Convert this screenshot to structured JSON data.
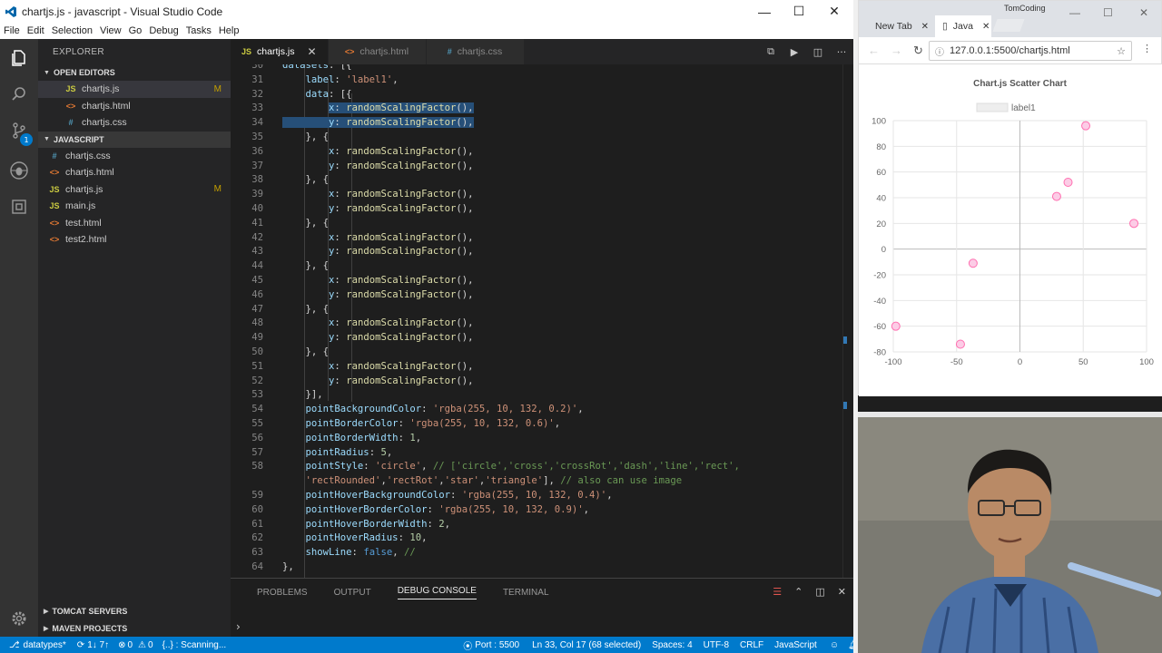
{
  "window": {
    "title": "chartjs.js - javascript - Visual Studio Code"
  },
  "menu": [
    "File",
    "Edit",
    "Selection",
    "View",
    "Go",
    "Debug",
    "Tasks",
    "Help"
  ],
  "activity": {
    "badge": "1"
  },
  "sidebar": {
    "header": "EXPLORER",
    "open_editors_title": "OPEN EDITORS",
    "open_editors": [
      {
        "icon": "JS",
        "name": "chartjs.js",
        "mod": "M"
      },
      {
        "icon": "<>",
        "name": "chartjs.html",
        "mod": ""
      },
      {
        "icon": "#",
        "name": "chartjs.css",
        "mod": ""
      }
    ],
    "folder_title": "JAVASCRIPT",
    "files": [
      {
        "icon": "#",
        "name": "chartjs.css",
        "mod": ""
      },
      {
        "icon": "<>",
        "name": "chartjs.html",
        "mod": ""
      },
      {
        "icon": "JS",
        "name": "chartjs.js",
        "mod": "M"
      },
      {
        "icon": "JS",
        "name": "main.js",
        "mod": ""
      },
      {
        "icon": "<>",
        "name": "test.html",
        "mod": ""
      },
      {
        "icon": "<>",
        "name": "test2.html",
        "mod": ""
      }
    ],
    "tomcat": "TOMCAT SERVERS",
    "maven": "MAVEN PROJECTS"
  },
  "tabs": [
    {
      "icon": "JS",
      "name": "chartjs.js",
      "active": true
    },
    {
      "icon": "<>",
      "name": "chartjs.html",
      "active": false
    },
    {
      "icon": "#",
      "name": "chartjs.css",
      "active": false
    }
  ],
  "code": [
    {
      "n": "30",
      "t": "datasets: [{"
    },
    {
      "n": "31",
      "t": "label: 'label1',"
    },
    {
      "n": "32",
      "t": "data: [{"
    },
    {
      "n": "33",
      "t": "x: randomScalingFactor(),"
    },
    {
      "n": "34",
      "t": "y: randomScalingFactor(),"
    },
    {
      "n": "35",
      "t": "}, {"
    },
    {
      "n": "36",
      "t": "x: randomScalingFactor(),"
    },
    {
      "n": "37",
      "t": "y: randomScalingFactor(),"
    },
    {
      "n": "38",
      "t": "}, {"
    },
    {
      "n": "39",
      "t": "x: randomScalingFactor(),"
    },
    {
      "n": "40",
      "t": "y: randomScalingFactor(),"
    },
    {
      "n": "41",
      "t": "}, {"
    },
    {
      "n": "42",
      "t": "x: randomScalingFactor(),"
    },
    {
      "n": "43",
      "t": "y: randomScalingFactor(),"
    },
    {
      "n": "44",
      "t": "}, {"
    },
    {
      "n": "45",
      "t": "x: randomScalingFactor(),"
    },
    {
      "n": "46",
      "t": "y: randomScalingFactor(),"
    },
    {
      "n": "47",
      "t": "}, {"
    },
    {
      "n": "48",
      "t": "x: randomScalingFactor(),"
    },
    {
      "n": "49",
      "t": "y: randomScalingFactor(),"
    },
    {
      "n": "50",
      "t": "}, {"
    },
    {
      "n": "51",
      "t": "x: randomScalingFactor(),"
    },
    {
      "n": "52",
      "t": "y: randomScalingFactor(),"
    },
    {
      "n": "53",
      "t": "}],"
    },
    {
      "n": "54",
      "t": "pointBackgroundColor: 'rgba(255, 10, 132, 0.2)',"
    },
    {
      "n": "55",
      "t": "pointBorderColor: 'rgba(255, 10, 132, 0.6)',"
    },
    {
      "n": "56",
      "t": "pointBorderWidth: 1,"
    },
    {
      "n": "57",
      "t": "pointRadius: 5,"
    },
    {
      "n": "58",
      "t": "pointStyle: 'circle', // ['circle','cross','crossRot','dash','line','rect',"
    },
    {
      "n": "",
      "t": "'rectRounded','rectRot','star','triangle'], // also can use image"
    },
    {
      "n": "59",
      "t": "pointHoverBackgroundColor: 'rgba(255, 10, 132, 0.4)',"
    },
    {
      "n": "60",
      "t": "pointHoverBorderColor: 'rgba(255, 10, 132, 0.9)',"
    },
    {
      "n": "61",
      "t": "pointHoverBorderWidth: 2,"
    },
    {
      "n": "62",
      "t": "pointHoverRadius: 10,"
    },
    {
      "n": "63",
      "t": "showLine: false, //"
    },
    {
      "n": "64",
      "t": "},"
    }
  ],
  "panel": {
    "tabs": [
      "PROBLEMS",
      "OUTPUT",
      "DEBUG CONSOLE",
      "TERMINAL"
    ],
    "active": "DEBUG CONSOLE",
    "prompt": "›"
  },
  "status": {
    "branch": "datatypes*",
    "sync": "1↓ 7↑",
    "errors": "0",
    "warnings": "0",
    "scan": "{..} : Scanning...",
    "port": "Port : 5500",
    "position": "Ln 33, Col 17 (68 selected)",
    "spaces": "Spaces: 4",
    "encoding": "UTF-8",
    "eol": "CRLF",
    "language": "JavaScript"
  },
  "browser": {
    "tabs": [
      "New Tab",
      "Java"
    ],
    "profile": "TomCoding",
    "url": "127.0.0.1:5500/chartjs.html"
  },
  "chart_data": {
    "type": "scatter",
    "title": "Chart.js Scatter Chart",
    "legend": [
      "label1"
    ],
    "legend_position": "top",
    "series": [
      {
        "name": "label1",
        "points": [
          [
            52,
            96
          ],
          [
            38,
            52
          ],
          [
            29,
            41
          ],
          [
            90,
            20
          ],
          [
            -37,
            -11
          ],
          [
            -98,
            -60
          ],
          [
            -47,
            -74
          ]
        ]
      }
    ],
    "xlim": [
      -100,
      100
    ],
    "ylim": [
      -80,
      100
    ],
    "xticks": [
      "-100",
      "-50",
      "0",
      "50",
      "100"
    ],
    "yticks": [
      "100",
      "80",
      "60",
      "40",
      "20",
      "0",
      "-20",
      "-40",
      "-60",
      "-80"
    ],
    "point_fill": "#fccce6",
    "point_stroke": "#ff6fb0",
    "grid": true
  }
}
